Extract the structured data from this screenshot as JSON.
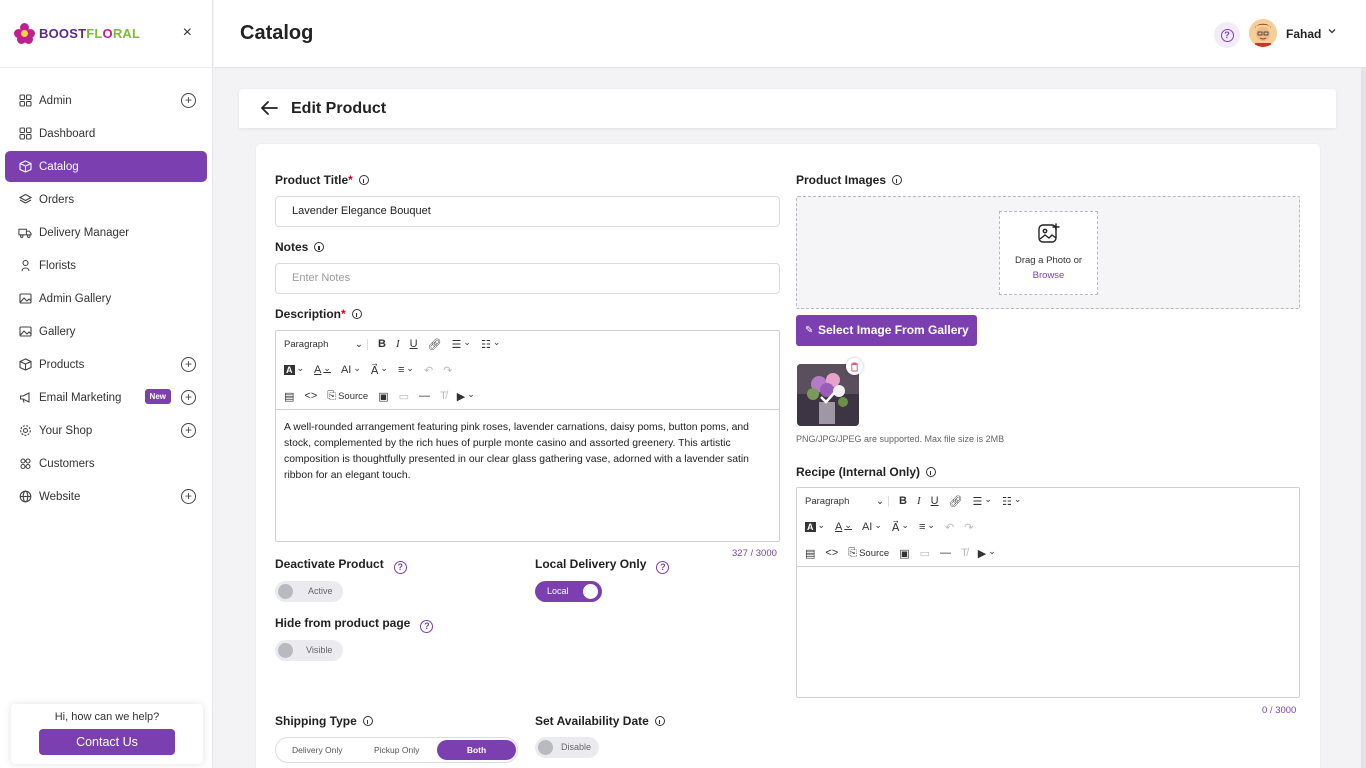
{
  "brand": {
    "part1": "BOOST",
    "part2": "FL",
    "part3": "O",
    "part4": "RAL"
  },
  "sidebar": {
    "close": "×",
    "items": [
      {
        "label": "Admin"
      },
      {
        "label": "Dashboard"
      },
      {
        "label": "Catalog"
      },
      {
        "label": "Orders"
      },
      {
        "label": "Delivery Manager"
      },
      {
        "label": "Florists"
      },
      {
        "label": "Admin Gallery"
      },
      {
        "label": "Gallery"
      },
      {
        "label": "Products"
      },
      {
        "label": "Email Marketing",
        "badge": "New"
      },
      {
        "label": "Your Shop"
      },
      {
        "label": "Customers"
      },
      {
        "label": "Website"
      }
    ]
  },
  "help": {
    "text": "Hi, how can we help?",
    "button": "Contact Us"
  },
  "header": {
    "title": "Catalog",
    "user": "Fahad"
  },
  "edit": {
    "title": "Edit Product",
    "product_title_label": "Product Title",
    "product_title_value": "Lavender Elegance Bouquet",
    "notes_label": "Notes",
    "notes_placeholder": "Enter Notes",
    "description_label": "Description",
    "description_text": "A well-rounded arrangement featuring pink roses, lavender carnations, daisy poms, button poms, and stock, complemented by the rich hues of purple monte casino and assorted greenery. This artistic composition is thoughtfully presented in our clear glass gathering vase, adorned with a lavender satin ribbon for an elegant touch.",
    "description_counter": "327 / 3000",
    "toolbar": {
      "paragraph": "Paragraph",
      "source": "Source"
    },
    "deactivate_label": "Deactivate Product",
    "deactivate_state": "Active",
    "local_label": "Local Delivery Only",
    "local_state": "Local",
    "hide_label": "Hide from product page",
    "hide_state": "Visible",
    "shipping_label": "Shipping Type",
    "shipping_options": [
      "Delivery Only",
      "Pickup Only",
      "Both"
    ],
    "availability_label": "Set Availability Date",
    "availability_state": "Disable",
    "images_label": "Product Images",
    "drop_text": "Drag a Photo or",
    "drop_browse": "Browse",
    "gallery_button": "Select Image From Gallery",
    "file_note": "PNG/JPG/JPEG are supported. Max file size is 2MB",
    "recipe_label": "Recipe (Internal Only)",
    "recipe_counter": "0 / 3000"
  },
  "colors": {
    "accent": "#7b3fb0",
    "brand_pink": "#c0208f",
    "brand_green": "#7bbf2a"
  }
}
